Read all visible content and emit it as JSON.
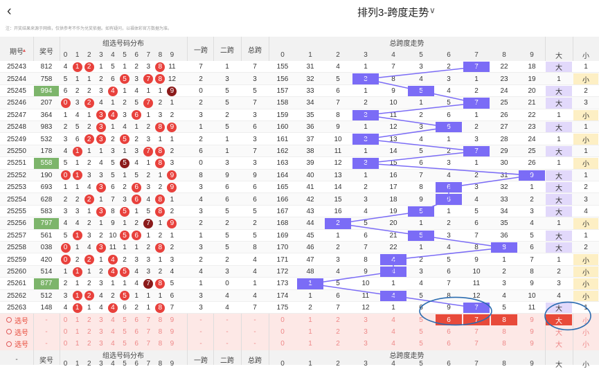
{
  "header": {
    "title": "排列3-跨度走势",
    "back_icon": "chevron-left-icon",
    "dropdown_icon": "chevron-down-icon"
  },
  "notice": "注：开奖结果来源于网络，仅供参考不作为兑奖依据。如有疑问，以福体彩官方数据为准。",
  "table": {
    "headers": {
      "period": "期号",
      "prize": "奖号",
      "group_dist": "组选号码分布",
      "span1": "一跨",
      "span2": "二跨",
      "total_span": "总跨",
      "trend": "总跨度走势",
      "digits": [
        "0",
        "1",
        "2",
        "3",
        "4",
        "5",
        "6",
        "7",
        "8",
        "9"
      ],
      "big": "大",
      "small": "小"
    },
    "rows": [
      {
        "p": "25243",
        "n": "812",
        "d": [
          4,
          1,
          2,
          1,
          5,
          1,
          2,
          3,
          8,
          11
        ],
        "s1": "7",
        "s2": "1",
        "t": "7",
        "miss": [
          "155",
          "31",
          "4",
          "1",
          "7",
          "3",
          "2",
          "7",
          "22",
          "18"
        ],
        "sz": [
          "大",
          "1"
        ]
      },
      {
        "p": "25244",
        "n": "758",
        "d": [
          5,
          1,
          1,
          2,
          6,
          5,
          3,
          7,
          8,
          12
        ],
        "s1": "2",
        "s2": "3",
        "t": "3",
        "miss": [
          "156",
          "32",
          "5",
          "3",
          "8",
          "4",
          "3",
          "1",
          "23",
          "19"
        ],
        "sz": [
          "1",
          "小"
        ]
      },
      {
        "p": "25245",
        "n": "994",
        "d": [
          6,
          2,
          2,
          3,
          4,
          1,
          4,
          1,
          1,
          9
        ],
        "s1": "0",
        "s2": "5",
        "t": "5",
        "miss": [
          "157",
          "33",
          "6",
          "1",
          "9",
          "5",
          "4",
          "2",
          "24",
          "20"
        ],
        "sz": [
          "大",
          "2"
        ]
      },
      {
        "p": "25246",
        "n": "207",
        "d": [
          0,
          3,
          2,
          4,
          1,
          2,
          5,
          7,
          2,
          1
        ],
        "s1": "2",
        "s2": "5",
        "t": "7",
        "miss": [
          "158",
          "34",
          "7",
          "2",
          "10",
          "1",
          "5",
          "7",
          "25",
          "21"
        ],
        "sz": [
          "大",
          "3"
        ]
      },
      {
        "p": "25247",
        "n": "364",
        "d": [
          1,
          4,
          1,
          3,
          4,
          3,
          6,
          1,
          3,
          2
        ],
        "s1": "3",
        "s2": "2",
        "t": "3",
        "miss": [
          "159",
          "35",
          "8",
          "3",
          "11",
          "2",
          "6",
          "1",
          "26",
          "22"
        ],
        "sz": [
          "1",
          "小"
        ]
      },
      {
        "p": "25248",
        "n": "983",
        "d": [
          2,
          5,
          2,
          3,
          1,
          4,
          1,
          2,
          8,
          9
        ],
        "s1": "1",
        "s2": "5",
        "t": "6",
        "miss": [
          "160",
          "36",
          "9",
          "1",
          "12",
          "3",
          "6",
          "2",
          "27",
          "23"
        ],
        "sz": [
          "大",
          "1"
        ]
      },
      {
        "p": "25249",
        "n": "532",
        "d": [
          3,
          6,
          2,
          3,
          2,
          5,
          2,
          3,
          1,
          1
        ],
        "s1": "2",
        "s2": "1",
        "t": "3",
        "miss": [
          "161",
          "37",
          "10",
          "3",
          "13",
          "4",
          "1",
          "3",
          "28",
          "24"
        ],
        "sz": [
          "1",
          "小"
        ]
      },
      {
        "p": "25250",
        "n": "178",
        "d": [
          4,
          1,
          1,
          1,
          3,
          1,
          3,
          7,
          8,
          2
        ],
        "s1": "6",
        "s2": "1",
        "t": "7",
        "miss": [
          "162",
          "38",
          "11",
          "1",
          "14",
          "5",
          "2",
          "7",
          "29",
          "25"
        ],
        "sz": [
          "大",
          "1"
        ]
      },
      {
        "p": "25251",
        "n": "558",
        "d": [
          5,
          1,
          2,
          4,
          5,
          5,
          4,
          1,
          8,
          3
        ],
        "s1": "0",
        "s2": "3",
        "t": "3",
        "miss": [
          "163",
          "39",
          "12",
          "3",
          "15",
          "6",
          "3",
          "1",
          "30",
          "26"
        ],
        "sz": [
          "1",
          "小"
        ]
      },
      {
        "p": "25252",
        "n": "190",
        "d": [
          0,
          1,
          3,
          3,
          5,
          1,
          5,
          2,
          1,
          9
        ],
        "s1": "8",
        "s2": "9",
        "t": "9",
        "miss": [
          "164",
          "40",
          "13",
          "1",
          "16",
          "7",
          "4",
          "2",
          "31",
          "9"
        ],
        "sz": [
          "大",
          "1"
        ]
      },
      {
        "p": "25253",
        "n": "693",
        "d": [
          1,
          1,
          4,
          3,
          6,
          2,
          6,
          3,
          2,
          9
        ],
        "s1": "3",
        "s2": "6",
        "t": "6",
        "miss": [
          "165",
          "41",
          "14",
          "2",
          "17",
          "8",
          "6",
          "3",
          "32",
          "1"
        ],
        "sz": [
          "大",
          "2"
        ]
      },
      {
        "p": "25254",
        "n": "628",
        "d": [
          2,
          2,
          2,
          1,
          7,
          3,
          6,
          4,
          8,
          1
        ],
        "s1": "4",
        "s2": "6",
        "t": "6",
        "miss": [
          "166",
          "42",
          "15",
          "3",
          "18",
          "9",
          "6",
          "4",
          "33",
          "2"
        ],
        "sz": [
          "大",
          "3"
        ]
      },
      {
        "p": "25255",
        "n": "583",
        "d": [
          3,
          3,
          1,
          3,
          8,
          5,
          1,
          5,
          8,
          2
        ],
        "s1": "3",
        "s2": "5",
        "t": "5",
        "miss": [
          "167",
          "43",
          "16",
          "4",
          "19",
          "5",
          "1",
          "5",
          "34",
          "3"
        ],
        "sz": [
          "大",
          "4"
        ]
      },
      {
        "p": "25256",
        "n": "797",
        "d": [
          4,
          4,
          2,
          1,
          9,
          1,
          2,
          7,
          1,
          9
        ],
        "s1": "2",
        "s2": "2",
        "t": "2",
        "miss": [
          "168",
          "44",
          "2",
          "5",
          "20",
          "1",
          "2",
          "6",
          "35",
          "4"
        ],
        "sz": [
          "1",
          "小"
        ]
      },
      {
        "p": "25257",
        "n": "561",
        "d": [
          5,
          1,
          3,
          2,
          10,
          5,
          6,
          1,
          2,
          1
        ],
        "s1": "1",
        "s2": "5",
        "t": "5",
        "miss": [
          "169",
          "45",
          "1",
          "6",
          "21",
          "5",
          "3",
          "7",
          "36",
          "5"
        ],
        "sz": [
          "大",
          "1"
        ]
      },
      {
        "p": "25258",
        "n": "038",
        "d": [
          0,
          1,
          4,
          3,
          11,
          1,
          1,
          2,
          8,
          2
        ],
        "s1": "3",
        "s2": "5",
        "t": "8",
        "miss": [
          "170",
          "46",
          "2",
          "7",
          "22",
          "1",
          "4",
          "8",
          "8",
          "6"
        ],
        "sz": [
          "大",
          "2"
        ]
      },
      {
        "p": "25259",
        "n": "420",
        "d": [
          0,
          2,
          2,
          1,
          4,
          2,
          3,
          3,
          1,
          3
        ],
        "s1": "2",
        "s2": "2",
        "t": "4",
        "miss": [
          "171",
          "47",
          "3",
          "8",
          "4",
          "2",
          "5",
          "9",
          "1",
          "7"
        ],
        "sz": [
          "1",
          "小"
        ]
      },
      {
        "p": "25260",
        "n": "514",
        "d": [
          1,
          1,
          1,
          2,
          4,
          5,
          4,
          3,
          2,
          4
        ],
        "s1": "4",
        "s2": "3",
        "t": "4",
        "miss": [
          "172",
          "48",
          "4",
          "9",
          "4",
          "3",
          "6",
          "10",
          "2",
          "8"
        ],
        "sz": [
          "2",
          "小"
        ]
      },
      {
        "p": "25261",
        "n": "877",
        "d": [
          2,
          1,
          2,
          3,
          1,
          1,
          4,
          7,
          8,
          5
        ],
        "s1": "1",
        "s2": "0",
        "t": "1",
        "miss": [
          "173",
          "1",
          "5",
          "10",
          "1",
          "4",
          "7",
          "11",
          "3",
          "9"
        ],
        "sz": [
          "3",
          "小"
        ]
      },
      {
        "p": "25262",
        "n": "512",
        "d": [
          3,
          1,
          2,
          4,
          2,
          5,
          1,
          1,
          1,
          6
        ],
        "s1": "3",
        "s2": "4",
        "t": "4",
        "miss": [
          "174",
          "1",
          "6",
          "11",
          "4",
          "5",
          "8",
          "12",
          "4",
          "10"
        ],
        "sz": [
          "4",
          "小"
        ]
      },
      {
        "p": "25263",
        "n": "148",
        "d": [
          4,
          1,
          1,
          4,
          1,
          6,
          2,
          1,
          8,
          7
        ],
        "s1": "3",
        "s2": "4",
        "t": "7",
        "miss": [
          "175",
          "2",
          "7",
          "12",
          "1",
          "6",
          "9",
          "7",
          "5",
          "11"
        ],
        "sz": [
          "大",
          "1"
        ]
      }
    ],
    "select_label": "选号",
    "dash": "-",
    "footer_prize": "奖号",
    "footer_group": "组选号码分布",
    "footer_span1": "一跨",
    "footer_span2": "二跨",
    "footer_total": "总跨",
    "footer_trend": "总跨度走势"
  },
  "colors": {
    "accent_purple": "#7b6cf6",
    "ball_red": "#e8413c",
    "ball_dark": "#8b1a1a",
    "select_red": "#e84a3a",
    "big_bg": "#e2d9fb",
    "small_bg": "#fdefc4",
    "green": "#7db56b"
  }
}
